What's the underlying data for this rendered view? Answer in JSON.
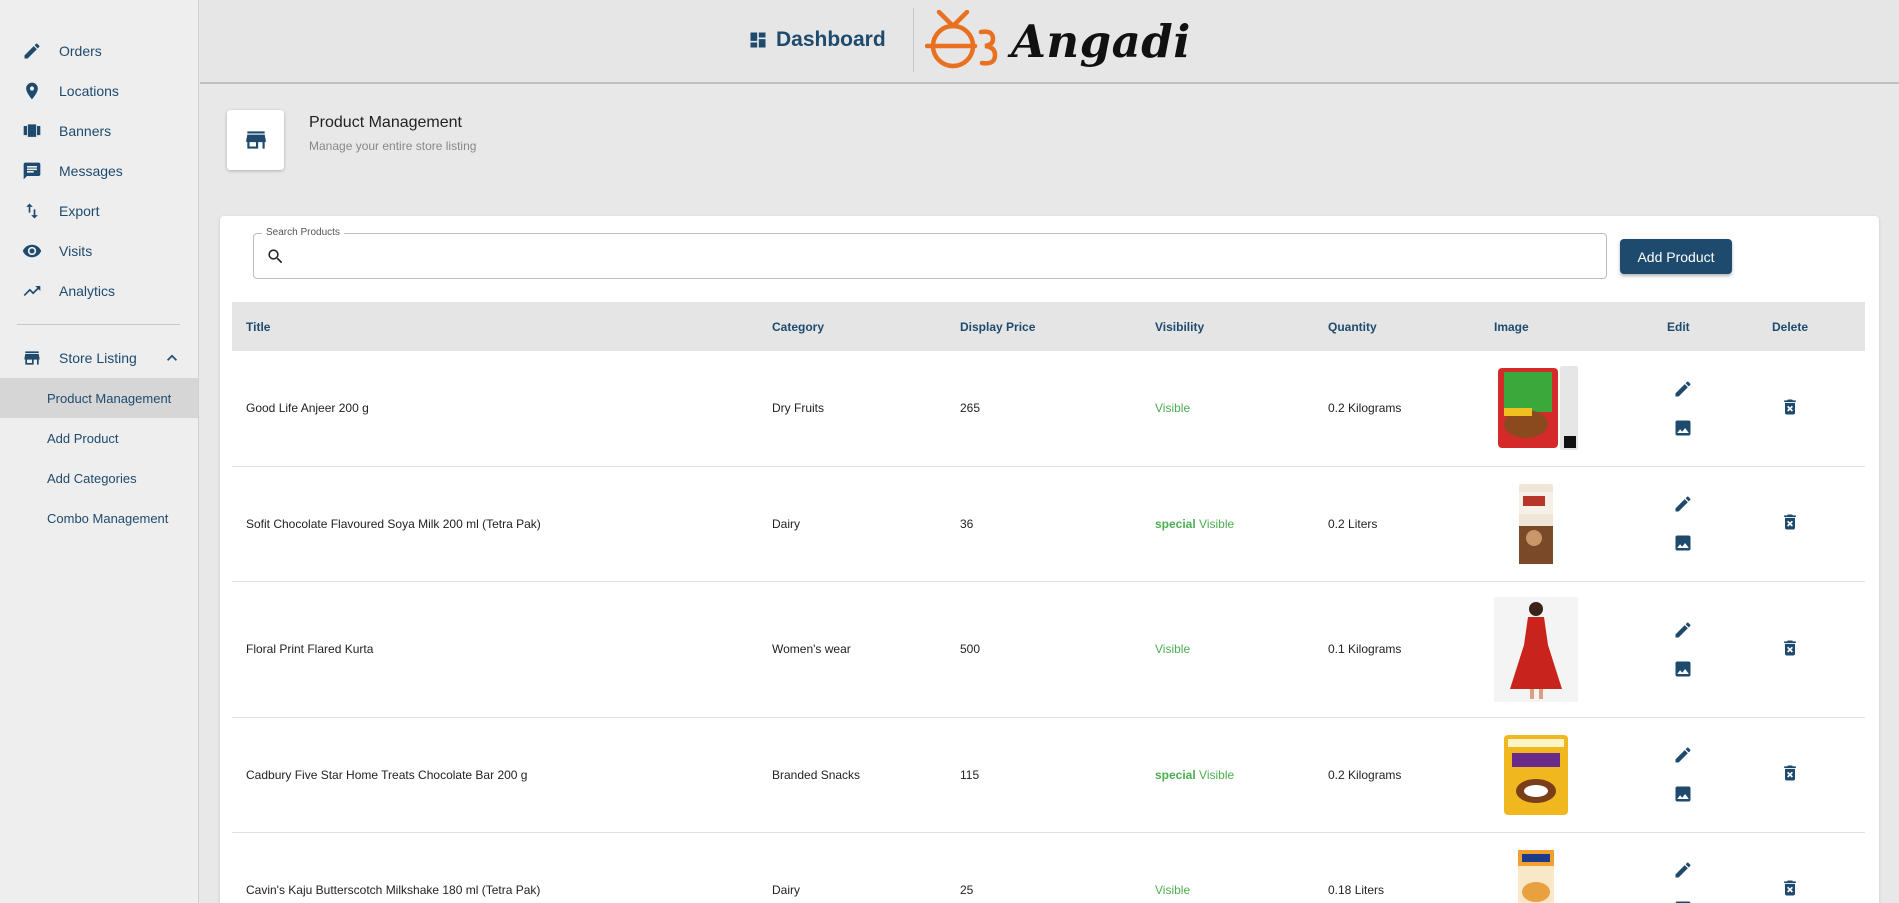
{
  "sidebar": {
    "items": [
      {
        "label": "Orders",
        "icon": "pencil-icon"
      },
      {
        "label": "Locations",
        "icon": "location-pin-icon"
      },
      {
        "label": "Banners",
        "icon": "carousel-icon"
      },
      {
        "label": "Messages",
        "icon": "message-icon"
      },
      {
        "label": "Export",
        "icon": "import-export-icon"
      },
      {
        "label": "Visits",
        "icon": "eye-icon"
      },
      {
        "label": "Analytics",
        "icon": "trending-up-icon"
      }
    ],
    "group": {
      "label": "Store Listing",
      "icon": "store-icon",
      "subitems": [
        {
          "label": "Product Management",
          "active": true
        },
        {
          "label": "Add Product",
          "active": false
        },
        {
          "label": "Add Categories",
          "active": false
        },
        {
          "label": "Combo Management",
          "active": false
        }
      ]
    }
  },
  "header": {
    "dashboard_label": "Dashboard",
    "logo_text": "Angadi",
    "brand_color": "#e8701f",
    "accent_color": "#1e4a6e"
  },
  "pagehead": {
    "title": "Product Management",
    "subtitle": "Manage your entire store listing"
  },
  "search": {
    "label": "Search Products",
    "value": ""
  },
  "add_button_label": "Add Product",
  "table": {
    "columns": [
      "Title",
      "Category",
      "Display Price",
      "Visibility",
      "Quantity",
      "Image",
      "Edit",
      "Delete"
    ],
    "rows": [
      {
        "title": "Good Life Anjeer 200 g",
        "category": "Dry Fruits",
        "price": "265",
        "special": "",
        "visibility": "Visible",
        "quantity": "0.2 Kilograms"
      },
      {
        "title": "Sofit Chocolate Flavoured Soya Milk 200 ml (Tetra Pak)",
        "category": "Dairy",
        "price": "36",
        "special": "special",
        "visibility": "Visible",
        "quantity": "0.2 Liters"
      },
      {
        "title": "Floral Print Flared Kurta",
        "category": "Women's wear",
        "price": "500",
        "special": "",
        "visibility": "Visible",
        "quantity": "0.1 Kilograms"
      },
      {
        "title": "Cadbury Five Star Home Treats Chocolate Bar 200 g",
        "category": "Branded Snacks",
        "price": "115",
        "special": "special",
        "visibility": "Visible",
        "quantity": "0.2 Kilograms"
      },
      {
        "title": "Cavin's Kaju Butterscotch Milkshake 180 ml (Tetra Pak)",
        "category": "Dairy",
        "price": "25",
        "special": "",
        "visibility": "Visible",
        "quantity": "0.18 Liters"
      }
    ]
  }
}
